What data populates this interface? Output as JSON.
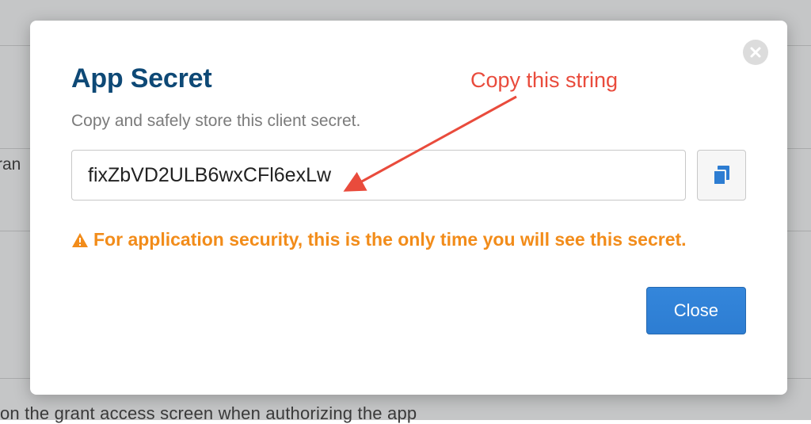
{
  "modal": {
    "title": "App Secret",
    "subtitle": "Copy and safely store this client secret.",
    "secret_value": "fixZbVD2ULB6wxCFl6exLw",
    "warning_text": "For application security, this is the only time you will see this secret.",
    "close_button_label": "Close"
  },
  "annotation": {
    "label": "Copy this string"
  },
  "background": {
    "left_cell_label": "ran",
    "footer_text": "on the grant access screen when authorizing the app"
  },
  "colors": {
    "title": "#0e4976",
    "accent_orange": "#f28c1a",
    "button_blue": "#2d7dd2",
    "annotation_red": "#e94b3c"
  }
}
